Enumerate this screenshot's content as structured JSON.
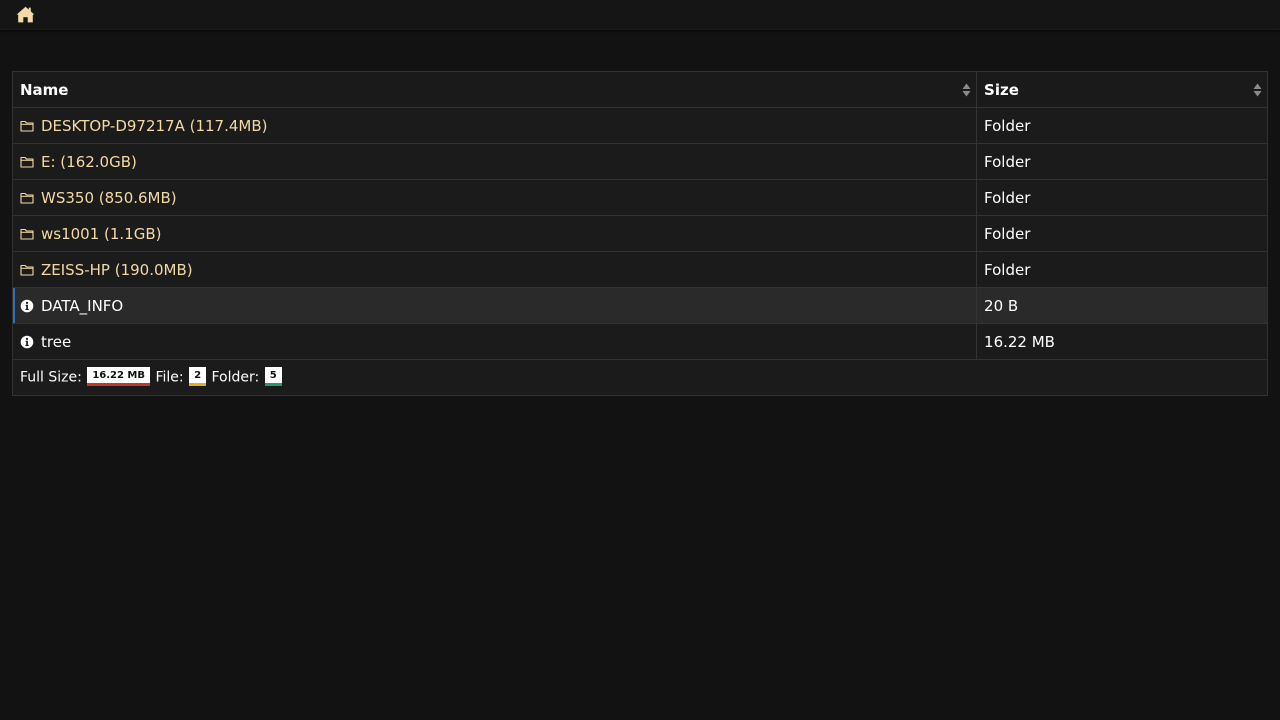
{
  "header": {
    "home_icon": "home-icon",
    "accent_color": "#f3d9a4"
  },
  "table": {
    "columns": [
      "Name",
      "Size"
    ],
    "rows": [
      {
        "icon": "folder-icon",
        "name": "DESKTOP-D97217A (117.4MB)",
        "size": "Folder",
        "type": "folder"
      },
      {
        "icon": "folder-icon",
        "name": "E: (162.0GB)",
        "size": "Folder",
        "type": "folder"
      },
      {
        "icon": "folder-icon",
        "name": "WS350 (850.6MB)",
        "size": "Folder",
        "type": "folder"
      },
      {
        "icon": "folder-icon",
        "name": "ws1001 (1.1GB)",
        "size": "Folder",
        "type": "folder"
      },
      {
        "icon": "folder-icon",
        "name": "ZEISS-HP (190.0MB)",
        "size": "Folder",
        "type": "folder"
      },
      {
        "icon": "info-icon",
        "name": "DATA_INFO",
        "size": "20 B",
        "type": "file"
      },
      {
        "icon": "info-icon",
        "name": "tree",
        "size": "16.22 MB",
        "type": "file"
      }
    ]
  },
  "footer": {
    "full_size_label": "Full Size:",
    "full_size_value": "16.22 MB",
    "file_label": "File:",
    "file_count": "2",
    "folder_label": "Folder:",
    "folder_count": "5",
    "colors": {
      "full_size": "#c0392b",
      "file": "#e0b020",
      "folder": "#1f9e6a"
    }
  }
}
